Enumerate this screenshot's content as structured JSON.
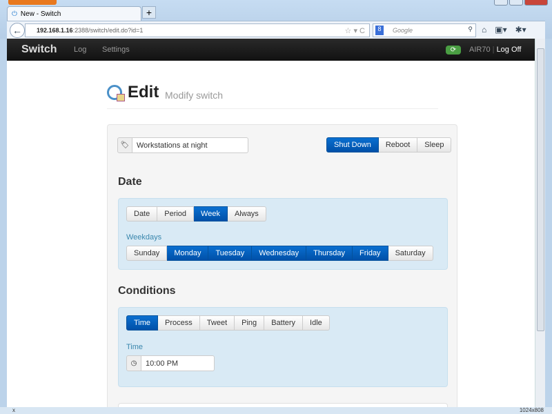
{
  "browser": {
    "tab_title": "New - Switch",
    "new_tab": "+",
    "url_host": "192.168.1.16",
    "url_rest": ":2388/switch/edit.do?id=1",
    "search_placeholder": "Google",
    "status_right": "1024x808",
    "status_left": "x"
  },
  "nav": {
    "brand": "Switch",
    "items": [
      "Log",
      "Settings"
    ],
    "user": "AIR70",
    "separator": "|",
    "logoff": "Log Off"
  },
  "header": {
    "title": "Edit",
    "subtitle": "Modify switch"
  },
  "form": {
    "name_value": "Workstations at night",
    "actions": [
      {
        "label": "Shut Down",
        "active": true
      },
      {
        "label": "Reboot",
        "active": false
      },
      {
        "label": "Sleep",
        "active": false
      }
    ]
  },
  "date": {
    "heading": "Date",
    "modes": [
      {
        "label": "Date",
        "active": false
      },
      {
        "label": "Period",
        "active": false
      },
      {
        "label": "Week",
        "active": true
      },
      {
        "label": "Always",
        "active": false
      }
    ],
    "weekdays_label": "Weekdays",
    "days": [
      {
        "label": "Sunday",
        "active": false
      },
      {
        "label": "Monday",
        "active": true
      },
      {
        "label": "Tuesday",
        "active": true
      },
      {
        "label": "Wednesday",
        "active": true
      },
      {
        "label": "Thursday",
        "active": true
      },
      {
        "label": "Friday",
        "active": true
      },
      {
        "label": "Saturday",
        "active": false
      }
    ]
  },
  "conditions": {
    "heading": "Conditions",
    "types": [
      {
        "label": "Time",
        "active": true
      },
      {
        "label": "Process",
        "active": false
      },
      {
        "label": "Tweet",
        "active": false
      },
      {
        "label": "Ping",
        "active": false
      },
      {
        "label": "Battery",
        "active": false
      },
      {
        "label": "Idle",
        "active": false
      }
    ],
    "time_label": "Time",
    "time_value": "10:00 PM"
  }
}
